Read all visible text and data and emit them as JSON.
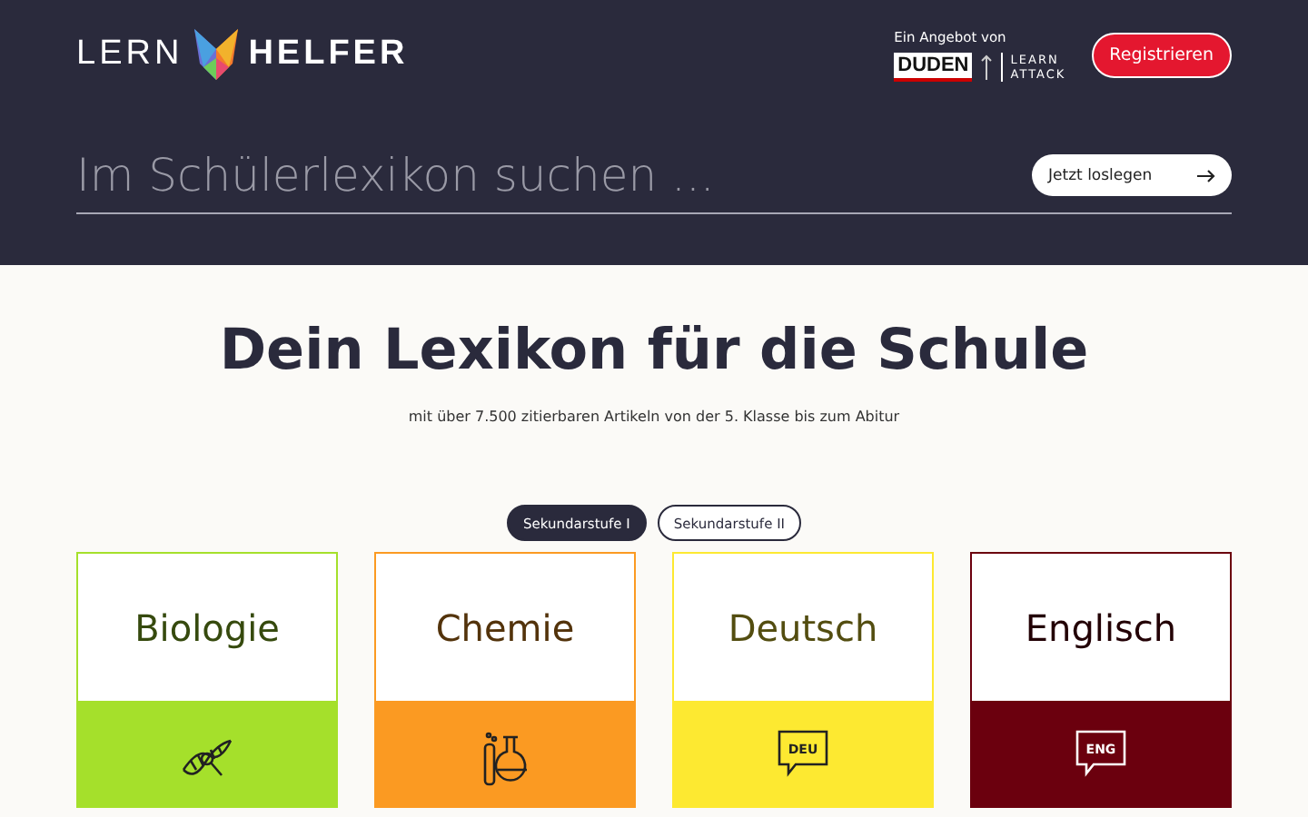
{
  "header": {
    "logo": {
      "left": "LERN",
      "right": "HELFER"
    },
    "offer_label": "Ein Angebot von",
    "partners": [
      {
        "kind": "duden",
        "text": "DUDEN"
      },
      {
        "kind": "learnattack",
        "lines": [
          "LEARN",
          "ATTACK"
        ]
      }
    ],
    "register_button": "Registrieren",
    "search": {
      "placeholder": "Im Schülerlexikon suchen ...",
      "button": "Jetzt loslegen"
    }
  },
  "hero": {
    "title": "Dein Lexikon für die Schule",
    "subtitle": "mit über 7.500 zitierbaren Artikeln von der 5. Klasse bis zum Abitur"
  },
  "levels": [
    {
      "label": "Sekundarstufe I",
      "selected": true
    },
    {
      "label": "Sekundarstufe II",
      "selected": false
    }
  ],
  "subjects": [
    {
      "name": "Biologie",
      "color": "#a5e02b",
      "kind": "dna"
    },
    {
      "name": "Chemie",
      "color": "#fb9a22",
      "kind": "flask"
    },
    {
      "name": "Deutsch",
      "color": "#fde931",
      "kind": "bubble",
      "icon_text": "DEU"
    },
    {
      "name": "Englisch",
      "color": "#6b000e",
      "kind": "bubble",
      "icon_text": "ENG"
    }
  ]
}
